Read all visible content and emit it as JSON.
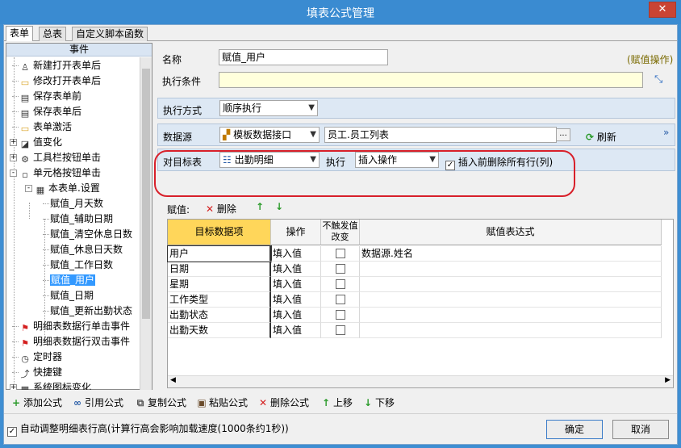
{
  "window": {
    "title": "填表公式管理",
    "close_label": "✕"
  },
  "tabs": [
    "表单",
    "总表",
    "自定义脚本函数"
  ],
  "events_header": "事件",
  "tree": [
    {
      "label": "新建打开表单后",
      "icon": "user-add-icon"
    },
    {
      "label": "修改打开表单后",
      "icon": "folder-open-icon"
    },
    {
      "label": "保存表单前",
      "icon": "save-icon"
    },
    {
      "label": "保存表单后",
      "icon": "save-icon"
    },
    {
      "label": "表单激活",
      "icon": "folder-icon"
    },
    {
      "label": "值变化",
      "icon": "value-change-icon"
    },
    {
      "label": "工具栏按钮单击",
      "icon": "tool-icon"
    },
    {
      "label": "单元格按钮单击",
      "icon": "cell-icon"
    },
    {
      "label": "本表单.设置",
      "icon": "form-icon"
    },
    {
      "label": "赋值_月天数"
    },
    {
      "label": "赋值_辅助日期"
    },
    {
      "label": "赋值_清空休息日数"
    },
    {
      "label": "赋值_休息日天数"
    },
    {
      "label": "赋值_工作日数"
    },
    {
      "label": "赋值_用户"
    },
    {
      "label": "赋值_日期"
    },
    {
      "label": "赋值_更新出勤状态"
    },
    {
      "label": "明细表数据行单击事件",
      "icon": "flag-icon"
    },
    {
      "label": "明细表数据行双击事件",
      "icon": "flag-icon"
    },
    {
      "label": "定时器",
      "icon": "timer-icon"
    },
    {
      "label": "快捷键",
      "icon": "shortcut-icon"
    },
    {
      "label": "系统图标变化",
      "icon": "system-icon"
    }
  ],
  "form": {
    "name_label": "名称",
    "name_value": "赋值_用户",
    "operation_tag": "(赋值操作)",
    "condition_label": "执行条件",
    "condition_value": "",
    "mode_label": "执行方式",
    "mode_value": "顺序执行",
    "source_label": "数据源",
    "source_type": "模板数据接口",
    "source_value": "员工.员工列表",
    "source_browse": "...",
    "refresh_label": "刷新",
    "target_label": "对目标表",
    "target_value": "出勤明细",
    "exec_label": "执行",
    "exec_value": "插入操作",
    "delete_before_label": "插入前删除所有行(列)"
  },
  "assign_bar": {
    "label": "赋值:",
    "delete_label": "删除"
  },
  "grid": {
    "headers": [
      "目标数据项",
      "操作",
      "不触发值改变",
      "赋值表达式"
    ],
    "rows": [
      {
        "target": "用户",
        "op": "填入值",
        "expr": "数据源.姓名"
      },
      {
        "target": "日期",
        "op": "填入值",
        "expr": ""
      },
      {
        "target": "星期",
        "op": "填入值",
        "expr": ""
      },
      {
        "target": "工作类型",
        "op": "填入值",
        "expr": ""
      },
      {
        "target": "出勤状态",
        "op": "填入值",
        "expr": ""
      },
      {
        "target": "出勤天数",
        "op": "填入值",
        "expr": ""
      }
    ]
  },
  "toolbar": {
    "add": "添加公式",
    "reference": "引用公式",
    "copy": "复制公式",
    "paste": "粘贴公式",
    "delete": "删除公式",
    "up": "上移",
    "down": "下移"
  },
  "footer": {
    "auto_adjust_label": "自动调整明细表行高(计算行高会影响加载速度(1000条约1秒))",
    "ok": "确定",
    "cancel": "取消"
  }
}
